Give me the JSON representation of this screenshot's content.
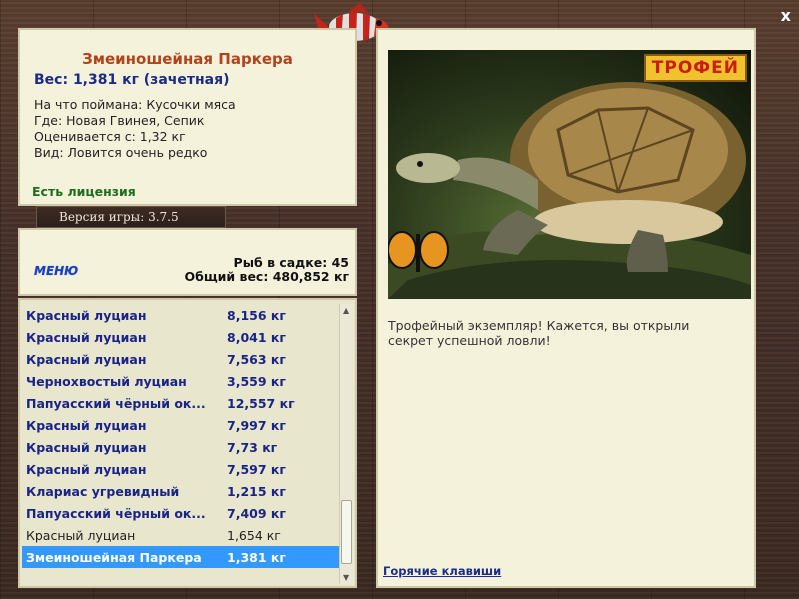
{
  "fish": {
    "name": "Змеиношейная Паркера",
    "weight_line": "Вес: 1,381 кг (зачетная)",
    "bait": "На что поймана: Кусочки мяса",
    "location": "Где: Новая Гвинея, Сепик",
    "min_weight": "Оценивается с: 1,32 кг",
    "rarity": "Вид: Ловится очень редко",
    "license": "Есть лицензия"
  },
  "version": "Версия игры: 3.7.5",
  "menu_label": "МЕНЮ",
  "stats": {
    "count": "Рыб в садке: 45",
    "total": "Общий вес: 480,852 кг"
  },
  "catch_list": [
    {
      "name": "Красный луциан",
      "weight": "8,156 кг"
    },
    {
      "name": "Красный луциан",
      "weight": "8,041 кг"
    },
    {
      "name": "Красный луциан",
      "weight": "7,563 кг"
    },
    {
      "name": "Чернохвостый луциан",
      "weight": "3,559 кг"
    },
    {
      "name": "Папуасский чёрный ок...",
      "weight": "12,557 кг"
    },
    {
      "name": "Красный луциан",
      "weight": "7,997 кг"
    },
    {
      "name": "Красный луциан",
      "weight": "7,73 кг"
    },
    {
      "name": "Красный луциан",
      "weight": "7,597 кг"
    },
    {
      "name": "Клариас угревидный",
      "weight": "1,215 кг"
    },
    {
      "name": "Папуасский чёрный ок...",
      "weight": "7,409 кг"
    },
    {
      "name": "Красный луциан",
      "weight": "1,654 кг"
    },
    {
      "name": "Змеиношейная Паркера",
      "weight": "1,381 кг"
    }
  ],
  "trophy": {
    "badge": "ТРОФЕЙ",
    "text": "Трофейный экземпляр! Кажется, вы открыли секрет успешной ловли!"
  },
  "hotkeys": "Горячие клавиши",
  "close": "x",
  "icons": {
    "close": "close-icon",
    "logo": "fish-logo-icon",
    "scroll_up": "scroll-up-arrow-icon",
    "scroll_down": "scroll-down-arrow-icon"
  },
  "colors": {
    "panel_bg": "#f5f2dc",
    "fish_name": "#b2431b",
    "list_text": "#1a2488",
    "selection": "#3399ff",
    "license": "#1e6e1e"
  }
}
